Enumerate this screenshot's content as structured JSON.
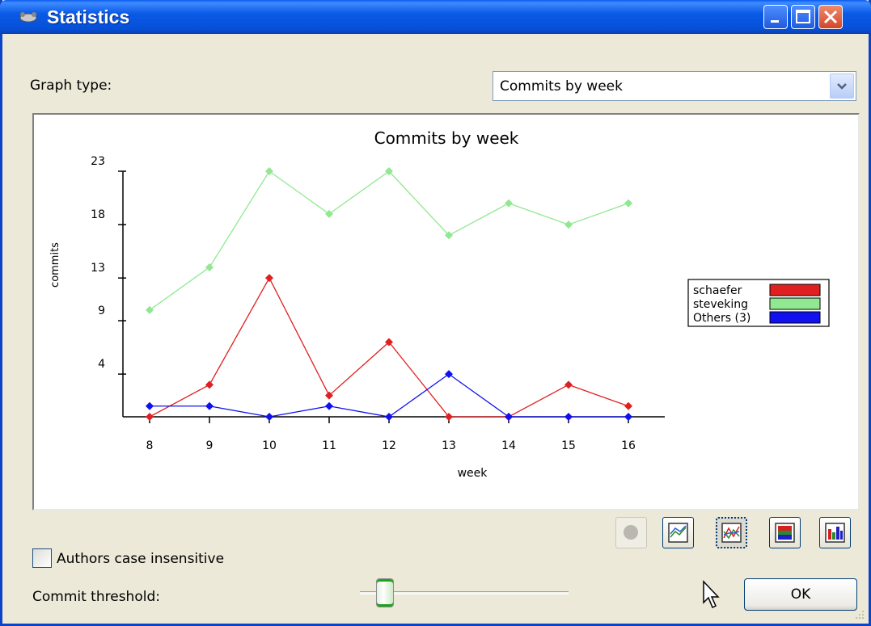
{
  "window": {
    "title": "Statistics"
  },
  "graph_type": {
    "label": "Graph type:",
    "selected": "Commits by week"
  },
  "options": {
    "authors_case_insensitive_label": "Authors case insensitive",
    "authors_case_insensitive_checked": false,
    "commit_threshold_label": "Commit threshold:",
    "commit_threshold_level": 0.12
  },
  "buttons": {
    "ok_label": "OK"
  },
  "toolbar": [
    {
      "name": "statistics-view-button",
      "icon": "circle-icon",
      "enabled": false
    },
    {
      "name": "line-graph-button",
      "icon": "line-graph-icon",
      "enabled": true
    },
    {
      "name": "stacked-line-graph-button",
      "icon": "stacked-line-graph-icon",
      "enabled": true,
      "selected": true
    },
    {
      "name": "stacked-bar-graph-button",
      "icon": "stacked-bar-graph-icon",
      "enabled": true
    },
    {
      "name": "bar-graph-button",
      "icon": "bar-graph-icon",
      "enabled": true
    }
  ],
  "chart_data": {
    "type": "line",
    "title": "Commits by week",
    "xlabel": "week",
    "ylabel": "commits",
    "x": [
      8,
      9,
      10,
      11,
      12,
      13,
      14,
      15,
      16
    ],
    "yticks": [
      4,
      9,
      13,
      18,
      23
    ],
    "ylim": [
      0,
      23
    ],
    "series": [
      {
        "name": "schaefer",
        "color": "#e02020",
        "values": [
          0,
          3,
          13,
          2,
          7,
          0,
          0,
          3,
          1
        ]
      },
      {
        "name": "steveking",
        "color": "#90e890",
        "values": [
          10,
          14,
          23,
          19,
          23,
          17,
          20,
          18,
          20
        ]
      },
      {
        "name": "Others (3)",
        "color": "#1010f0",
        "values": [
          1,
          1,
          0,
          1,
          0,
          4,
          0,
          0,
          0
        ]
      }
    ],
    "legend_position": "right"
  }
}
